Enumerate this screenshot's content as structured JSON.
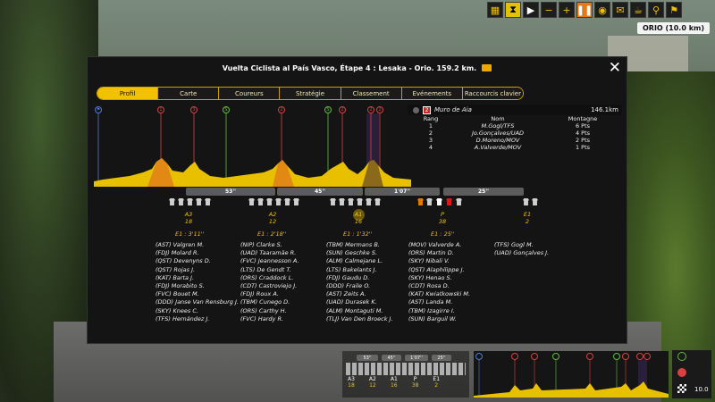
{
  "topbar": {
    "buttons": [
      "tile-icon",
      "hourglass-icon",
      "play-icon",
      "minus-icon",
      "plus-icon",
      "pause-icon",
      "eye-icon",
      "mail-icon",
      "cup-icon",
      "bike-icon",
      "flag-icon"
    ],
    "location": "ORIO (10.0 km)"
  },
  "panel": {
    "title": "Vuelta Ciclista al País Vasco, Étape 4 : Lesaka - Orio. 159.2 km.",
    "tabs": [
      "Profil",
      "Carte",
      "Coureurs",
      "Stratégie",
      "Classement",
      "Evénements",
      "Raccourcis clavier"
    ],
    "active_tab": "Profil"
  },
  "profile": {
    "markers": [
      {
        "label": "⚑",
        "color": "#4e7bd6"
      },
      {
        "label": "1",
        "color": "#d94040"
      },
      {
        "label": "3",
        "color": "#d94040"
      },
      {
        "label": "S",
        "color": "#5fbe3c"
      },
      {
        "label": "2",
        "color": "#d94040"
      },
      {
        "label": "S",
        "color": "#5fbe3c"
      },
      {
        "label": "2",
        "color": "#d94040"
      },
      {
        "label": "2",
        "color": "#d94040"
      },
      {
        "label": "2",
        "color": "#d94040"
      }
    ]
  },
  "climb": {
    "num": "2",
    "name": "Muro de Aia",
    "distance": "146.1km",
    "headers": {
      "rank": "Rang",
      "name": "Nom",
      "points": "Montagne"
    },
    "rows": [
      {
        "rank": "1",
        "name": "M.Gogl/TFS",
        "points": "6 Pts"
      },
      {
        "rank": "2",
        "name": "Jo.Gonçalves/UAD",
        "points": "4 Pts"
      },
      {
        "rank": "3",
        "name": "D.Moreno/MOV",
        "points": "2 Pts"
      },
      {
        "rank": "4",
        "name": "A.Valverde/MOV",
        "points": "1 Pts"
      }
    ]
  },
  "gaps": [
    "53''",
    "45''",
    "1'07''",
    "25''"
  ],
  "groups": [
    {
      "label": "A3",
      "count": "18",
      "time": "E1 : 3'11''"
    },
    {
      "label": "A2",
      "count": "12",
      "time": "E1 : 2'18''"
    },
    {
      "label": "A1",
      "count": "16",
      "time": "E1 : 1'32''"
    },
    {
      "label": "P",
      "count": "38",
      "time": "E1 : 25''"
    },
    {
      "label": "E1",
      "count": "2",
      "time": ""
    }
  ],
  "riders": [
    [
      "(AST) Valgren M.",
      "(FDJ) Molard R.",
      "(QST) Devenyns D.",
      "(QST) Rojas J.",
      "(KAT) Barta J.",
      "(FDJ) Morabito S.",
      "(FVC) Bouet M.",
      "(DDD) Janse Van Rensburg J.",
      "(SKY) Knees C.",
      "(TFS) Hernández J."
    ],
    [
      "(NIP) Clarke S.",
      "(UAD) Taaramäe R.",
      "(FVC) Jeannesson A.",
      "(LTS) De Gendt T.",
      "(ORS) Craddock L.",
      "(CDT) Castroviejo J.",
      "(FDJ) Roux A.",
      "(TBM) Cunego D.",
      "(ORS) Carthy H.",
      "(FVC) Hardy R."
    ],
    [
      "(TBM) Mermans B.",
      "(SUN) Geschke S.",
      "(ALM) Calmejane L.",
      "(LTS) Bakelants J.",
      "(FDJ) Gaudu D.",
      "(DDD) Fraile O.",
      "(AST) Zeits A.",
      "(UAD) Durasek K.",
      "(ALM) Montaguti M.",
      "(TLJ) Van Den Broeck J."
    ],
    [
      "(MOV) Valverde A.",
      "(ORS) Martin D.",
      "(SKY) Nibali V.",
      "(QST) Alaphilippe J.",
      "(SKY) Henao S.",
      "(CDT) Rosa D.",
      "(KAT) Kwiatkowski M.",
      "(AST) Landa M.",
      "(TBM) Izagirre I.",
      "(SUN) Barguil W."
    ],
    [
      "(TFS) Gogl M.",
      "(UAD) Gonçalves J."
    ]
  ],
  "mini": {
    "gaps": [
      "53''",
      "45''",
      "1'07''",
      "25''"
    ],
    "labels": [
      [
        "A3",
        "18"
      ],
      [
        "A2",
        "12"
      ],
      [
        "A1",
        "16"
      ],
      [
        "P",
        "38"
      ],
      [
        "E1",
        "2"
      ]
    ],
    "speed": "10.0"
  }
}
